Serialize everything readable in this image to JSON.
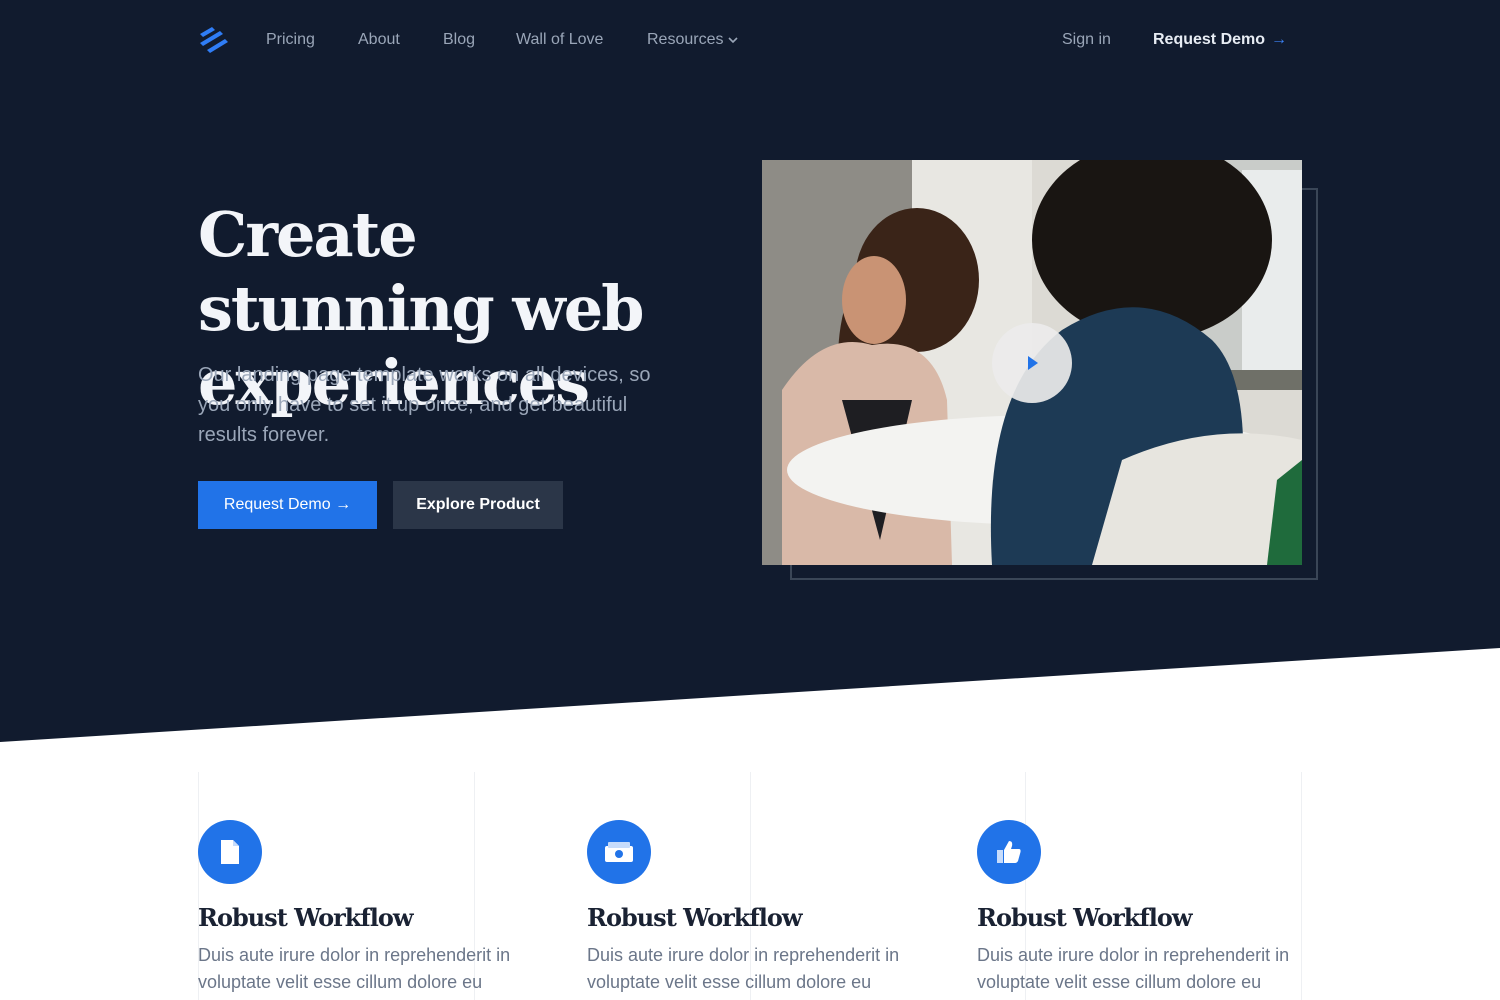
{
  "nav": {
    "links": [
      "Pricing",
      "About",
      "Blog",
      "Wall of Love"
    ],
    "resources_label": "Resources",
    "sign_in": "Sign in",
    "request_demo": "Request Demo",
    "request_demo_arrow": "→"
  },
  "hero": {
    "title": "Create stunning web experiences",
    "subtitle": "Our landing page template works on all devices, so you only have to set it up once, and get beautiful results forever.",
    "primary_button": "Request Demo →",
    "secondary_button": "Explore Product"
  },
  "features": [
    {
      "icon": "document-icon",
      "title": "Robust Workflow",
      "text": "Duis aute irure dolor in reprehenderit in voluptate velit esse cillum dolore eu"
    },
    {
      "icon": "money-icon",
      "title": "Robust Workflow",
      "text": "Duis aute irure dolor in reprehenderit in voluptate velit esse cillum dolore eu"
    },
    {
      "icon": "thumbs-up-icon",
      "title": "Robust Workflow",
      "text": "Duis aute irure dolor in reprehenderit in voluptate velit esse cillum dolore eu"
    }
  ],
  "colors": {
    "hero_background": "#111b2e",
    "accent": "#2173e8",
    "secondary_button": "#2b3648"
  }
}
